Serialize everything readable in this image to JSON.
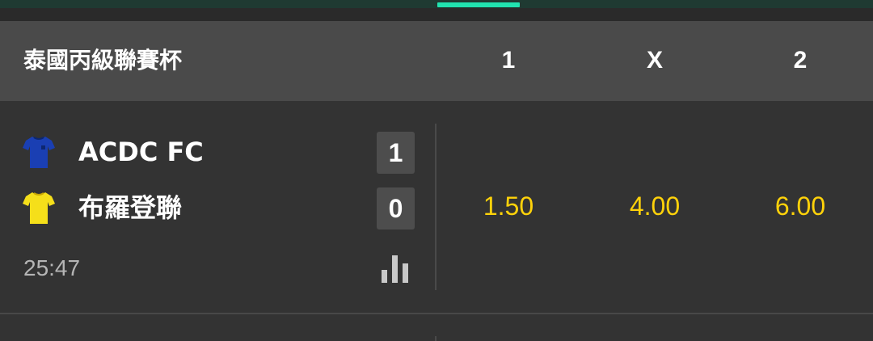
{
  "header": {
    "league_title": "泰國丙級聯賽杯",
    "columns": [
      "1",
      "X",
      "2"
    ]
  },
  "event": {
    "home": {
      "name": "ACDC FC",
      "score": "1",
      "jersey_color": "#1a3fb3",
      "jersey_icon": "jersey-icon"
    },
    "away": {
      "name": "布羅登聯",
      "score": "0",
      "jersey_color": "#f5df1a",
      "jersey_icon": "jersey-icon"
    },
    "clock": "25:47",
    "odds": {
      "home": "1.50",
      "draw": "4.00",
      "away": "6.00"
    }
  },
  "colors": {
    "accent": "#21e4b0",
    "odds": "#ffd20a",
    "header_bg": "#4a4a4a",
    "row_bg": "#333333"
  }
}
